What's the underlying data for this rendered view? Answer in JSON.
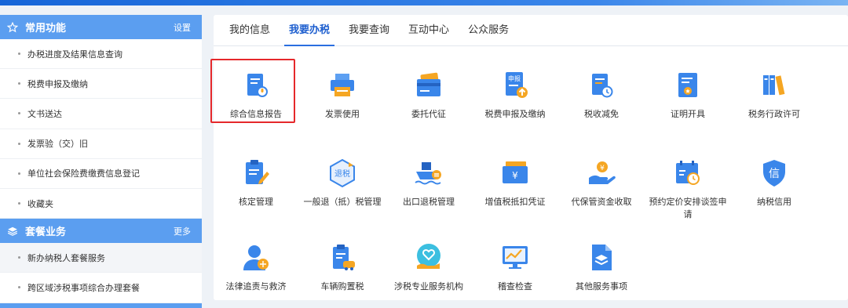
{
  "sidebar": {
    "common": {
      "title": "常用功能",
      "link": "设置"
    },
    "common_items": [
      "办税进度及结果信息查询",
      "税费申报及缴纳",
      "文书送达",
      "发票验（交）旧",
      "单位社会保险费缴费信息登记",
      "收藏夹"
    ],
    "package": {
      "title": "套餐业务",
      "link": "更多"
    },
    "package_items": [
      "新办纳税人套餐服务",
      "跨区域涉税事项综合办理套餐"
    ]
  },
  "tabs": [
    "我的信息",
    "我要办税",
    "我要查询",
    "互动中心",
    "公众服务"
  ],
  "active_tab": "我要办税",
  "services": [
    {
      "label": "综合信息报告",
      "icon": "document-mic-icon"
    },
    {
      "label": "发票使用",
      "icon": "printer-icon"
    },
    {
      "label": "委托代征",
      "icon": "cards-icon"
    },
    {
      "label": "税费申报及缴纳",
      "icon": "declare-upload-icon"
    },
    {
      "label": "税收减免",
      "icon": "document-clock-icon"
    },
    {
      "label": "证明开具",
      "icon": "certificate-icon"
    },
    {
      "label": "税务行政许可",
      "icon": "binders-icon"
    },
    {
      "label": "核定管理",
      "icon": "clipboard-pen-icon"
    },
    {
      "label": "一般退（抵）税管理",
      "icon": "refund-hexagon-icon"
    },
    {
      "label": "出口退税管理",
      "icon": "ship-icon"
    },
    {
      "label": "增值税抵扣凭证",
      "icon": "yuan-voucher-icon"
    },
    {
      "label": "代保管资金收取",
      "icon": "hand-coin-icon"
    },
    {
      "label": "预约定价安排谈签申请",
      "icon": "calendar-clock-icon"
    },
    {
      "label": "纳税信用",
      "icon": "credit-shield-icon"
    },
    {
      "label": "法律追责与救济",
      "icon": "legal-person-icon"
    },
    {
      "label": "车辆购置税",
      "icon": "vehicle-clipboard-icon"
    },
    {
      "label": "涉税专业服务机构",
      "icon": "heart-hand-icon"
    },
    {
      "label": "稽查检查",
      "icon": "monitor-chart-icon"
    },
    {
      "label": "其他服务事项",
      "icon": "layers-doc-icon"
    }
  ],
  "highlighted_service": "综合信息报告",
  "colors": {
    "accent": "#2a6ee0",
    "sidebar_header": "#5b9ef0",
    "highlight_border": "#e5282b",
    "icon_blue": "#3a86ea",
    "icon_orange": "#f5a623"
  }
}
